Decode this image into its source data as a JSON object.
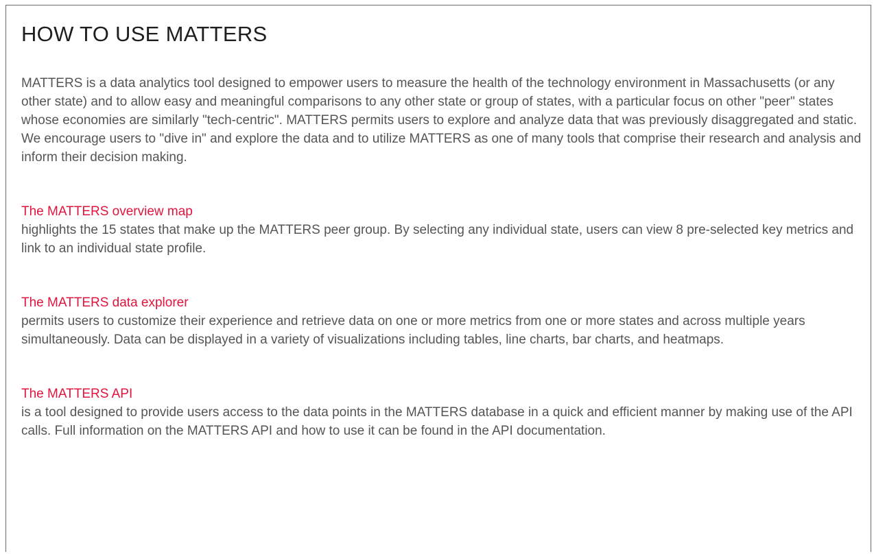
{
  "page": {
    "title": "HOW TO USE MATTERS",
    "intro": "MATTERS is a data analytics tool designed to empower users to measure the health of the technology environment in Massachusetts (or any other state) and to allow easy and meaningful comparisons to any other state or group of states, with a particular focus on other \"peer\" states whose economies are similarly \"tech-centric\". MATTERS permits users to explore and analyze data that was previously disaggregated and static. We encourage users to \"dive in\" and explore the data and to utilize MATTERS as one of many tools that comprise their research and analysis and inform their decision making."
  },
  "sections": [
    {
      "title": "The MATTERS overview map",
      "text": "highlights the 15 states that make up the MATTERS peer group. By selecting any individual state, users can view 8 pre-selected key metrics and link to an individual state profile."
    },
    {
      "title": "The MATTERS data explorer",
      "text": "permits users to customize their experience and retrieve data on one or more metrics from one or more states and across multiple years simultaneously. Data can be displayed in a variety of visualizations including tables, line charts, bar charts, and heatmaps."
    },
    {
      "title": "The MATTERS API",
      "text": "is a tool designed to provide users access to the data points in the MATTERS database in a quick and efficient manner by making use of the API calls. Full information on the MATTERS API and how to use it can be found in the API documentation."
    }
  ],
  "colors": {
    "heading": "#1e1e1e",
    "body_text": "#555555",
    "link": "#e2143d",
    "border": "#6b6b6b"
  }
}
